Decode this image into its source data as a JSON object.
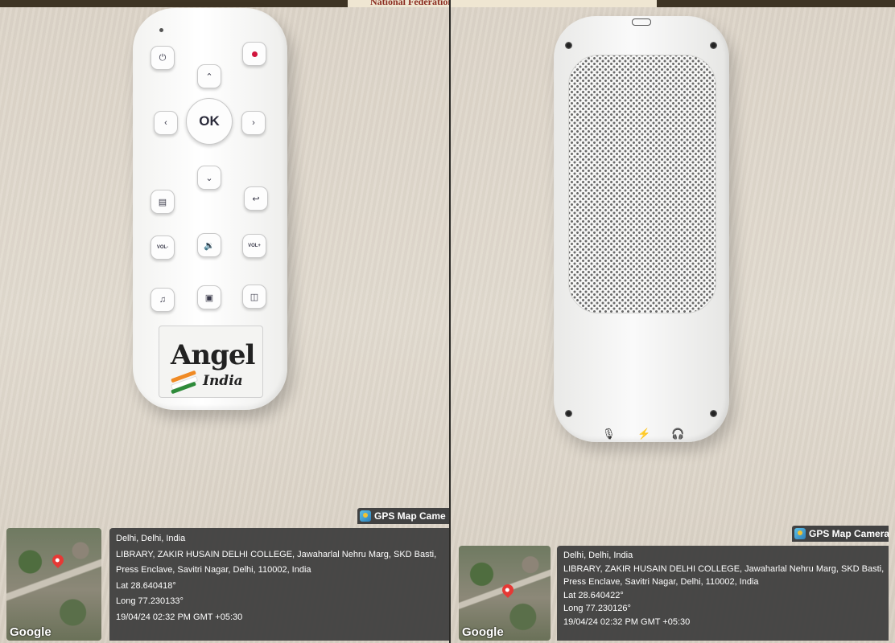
{
  "photos": [
    {
      "header_text": "National Federation of the Blind",
      "remote_front": {
        "ok_label": "OK",
        "vol_minus_label": "VOL-",
        "vol_plus_label": "VOL+",
        "sticker_brand": "Angel",
        "sticker_country": "India"
      },
      "gps": {
        "badge": "GPS Map Came",
        "map_brand": "Google",
        "city": "Delhi, Delhi, India",
        "address_line1": "LIBRARY, ZAKIR HUSAIN DELHI COLLEGE, Jawaharlal Nehru Marg, SKD Basti,",
        "address_line2": "Press Enclave, Savitri Nagar, Delhi, 110002, India",
        "lat": "Lat 28.640418°",
        "long": "Long 77.230133°",
        "datetime": "19/04/24 02:32 PM GMT +05:30"
      }
    },
    {
      "gps": {
        "badge": "GPS Map Camera",
        "map_brand": "Google",
        "city": "Delhi, Delhi, India",
        "address_line1": "LIBRARY, ZAKIR HUSAIN DELHI COLLEGE, Jawaharlal Nehru Marg, SKD Basti,",
        "address_line2": "Press Enclave, Savitri Nagar, Delhi, 110002, India",
        "lat": "Lat 28.640422°",
        "long": "Long 77.230126°",
        "datetime": "19/04/24 02:32 PM GMT +05:30"
      }
    }
  ],
  "colors": {
    "table_surface": "#e0d8cc",
    "remote_body": "#f7f7f5",
    "overlay_panel": "#3c3c3c",
    "power_dot": "#d0143c",
    "flag_saffron": "#f08a24",
    "flag_green": "#2e8b3a"
  },
  "icons": [
    "power-icon",
    "record-icon",
    "up-arrow-icon",
    "down-arrow-icon",
    "left-arrow-icon",
    "right-arrow-icon",
    "document-icon",
    "return-icon",
    "speaker-icon",
    "music-note-icon",
    "radio-icon",
    "book-icon",
    "map-pin-icon",
    "gps-camera-logo-icon",
    "microphone-icon",
    "usb-icon",
    "headphone-icon"
  ]
}
